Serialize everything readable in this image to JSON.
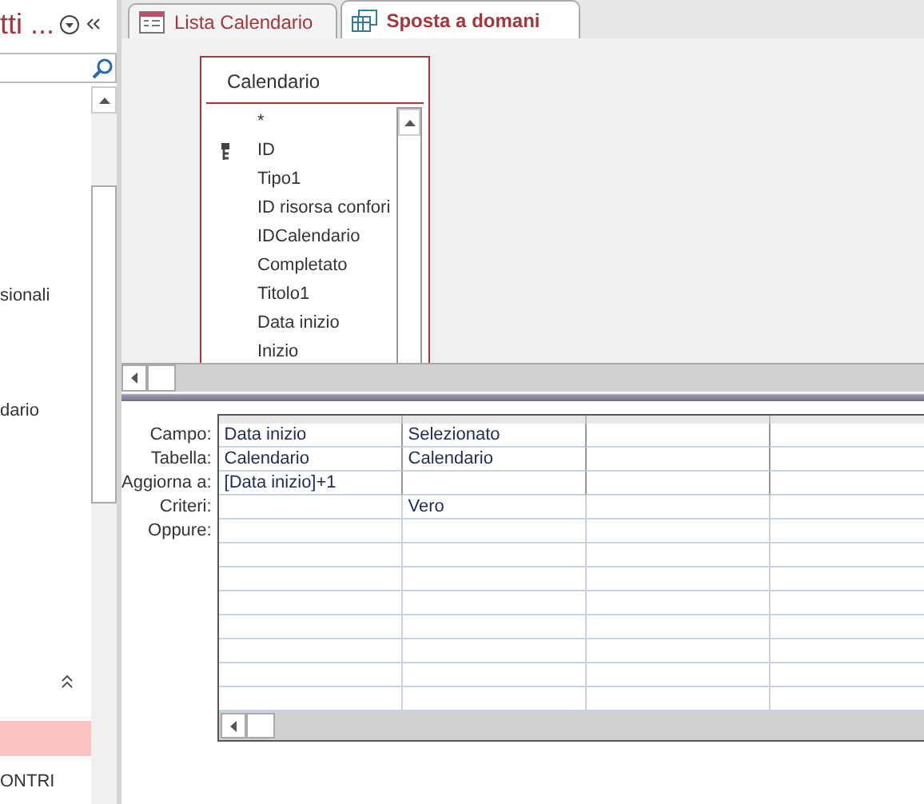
{
  "nav": {
    "title": "tti ...",
    "items": [
      {
        "label": "sionali",
        "selected": false
      },
      {
        "label": "dario",
        "selected": false
      },
      {
        "selected": true
      },
      {
        "label": "ONTRI",
        "selected": false
      }
    ]
  },
  "tabs": [
    {
      "label": "Lista Calendario",
      "kind": "form",
      "selected": false
    },
    {
      "label": "Sposta a domani",
      "kind": "query",
      "selected": true
    }
  ],
  "table": {
    "name": "Calendario",
    "fields": [
      {
        "name": "*",
        "key": false
      },
      {
        "name": "ID",
        "key": true
      },
      {
        "name": "Tipo1",
        "key": false
      },
      {
        "name": "ID risorsa confori",
        "key": false
      },
      {
        "name": "IDCalendario",
        "key": false
      },
      {
        "name": "Completato",
        "key": false
      },
      {
        "name": "Titolo1",
        "key": false
      },
      {
        "name": "Data inizio",
        "key": false
      },
      {
        "name": "Inizio",
        "key": false
      }
    ]
  },
  "grid": {
    "rows": [
      {
        "label": "Campo:",
        "cells": [
          "Data inizio",
          "Selezionato"
        ]
      },
      {
        "label": "Tabella:",
        "cells": [
          "Calendario",
          "Calendario"
        ]
      },
      {
        "label": "Aggiorna a:",
        "cells": [
          "[Data inizio]+1"
        ]
      },
      {
        "label": "Criteri:",
        "cells": [
          null,
          "Vero"
        ]
      },
      {
        "label": "Oppure:"
      }
    ]
  }
}
